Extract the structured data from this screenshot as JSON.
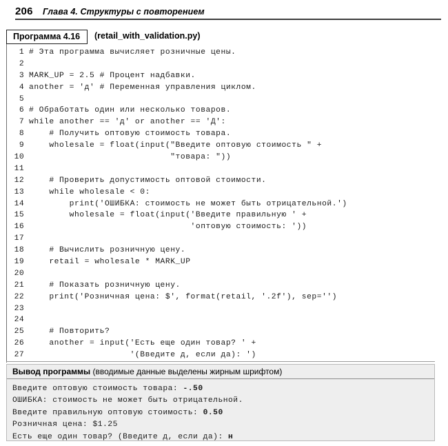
{
  "header": {
    "page_number": "206",
    "chapter_title": "Глава 4. Структуры с повторением"
  },
  "listing": {
    "badge": "Программа 4.16",
    "filename": "(retail_with_validation.py)",
    "lines": [
      {
        "n": "1",
        "text": "# Эта программа вычисляет розничные цены."
      },
      {
        "n": "2",
        "text": ""
      },
      {
        "n": "3",
        "text": "MARK_UP = 2.5 # Процент надбавки."
      },
      {
        "n": "4",
        "text": "another = 'д' # Переменная управления циклом."
      },
      {
        "n": "5",
        "text": ""
      },
      {
        "n": "6",
        "text": "# Обработать один или несколько товаров."
      },
      {
        "n": "7",
        "text": "while another == 'д' or another == 'Д':"
      },
      {
        "n": "8",
        "text": "    # Получить оптовую стоимость товара."
      },
      {
        "n": "9",
        "text": "    wholesale = float(input(\"Введите оптовую стоимость \" +"
      },
      {
        "n": "10",
        "text": "                            \"товара: \"))"
      },
      {
        "n": "11",
        "text": ""
      },
      {
        "n": "12",
        "text": "    # Проверить допустимость оптовой стоимости."
      },
      {
        "n": "13",
        "text": "    while wholesale < 0:"
      },
      {
        "n": "14",
        "text": "        print('ОШИБКА: стоимость не может быть отрицательной.')"
      },
      {
        "n": "15",
        "text": "        wholesale = float(input('Введите правильную ' +"
      },
      {
        "n": "16",
        "text": "                                'оптовую стоимость: '))"
      },
      {
        "n": "17",
        "text": ""
      },
      {
        "n": "18",
        "text": "    # Вычислить розничную цену."
      },
      {
        "n": "19",
        "text": "    retail = wholesale * MARK_UP"
      },
      {
        "n": "20",
        "text": ""
      },
      {
        "n": "21",
        "text": "    # Показать розничную цену."
      },
      {
        "n": "22",
        "text": "    print('Розничная цена: $', format(retail, '.2f'), sep='')"
      },
      {
        "n": "23",
        "text": ""
      },
      {
        "n": "24",
        "text": ""
      },
      {
        "n": "25",
        "text": "    # Повторить?"
      },
      {
        "n": "26",
        "text": "    another = input('Есть еще один товар? ' +"
      },
      {
        "n": "27",
        "text": "                    '(Введите д, если да): ')"
      }
    ]
  },
  "output": {
    "head_strong": "Вывод программы",
    "head_normal": " (вводимые данные выделены жирным шрифтом)",
    "lines": [
      {
        "prompt": "Введите оптовую стоимость товара: ",
        "input": "-.50"
      },
      {
        "prompt": "ОШИБКА: стоимость не может быть отрицательной.",
        "input": ""
      },
      {
        "prompt": "Введите правильную оптовую стоимость: ",
        "input": "0.50"
      },
      {
        "prompt": "Розничная цена: $1.25",
        "input": ""
      },
      {
        "prompt": "Есть еще один товар? (Введите д, если да): ",
        "input": "н"
      }
    ]
  },
  "colors": {
    "rule": "#3b3b3b",
    "output_bg": "#eeeeee",
    "output_border": "#b9b9b9",
    "text": "#1a1a1a"
  }
}
